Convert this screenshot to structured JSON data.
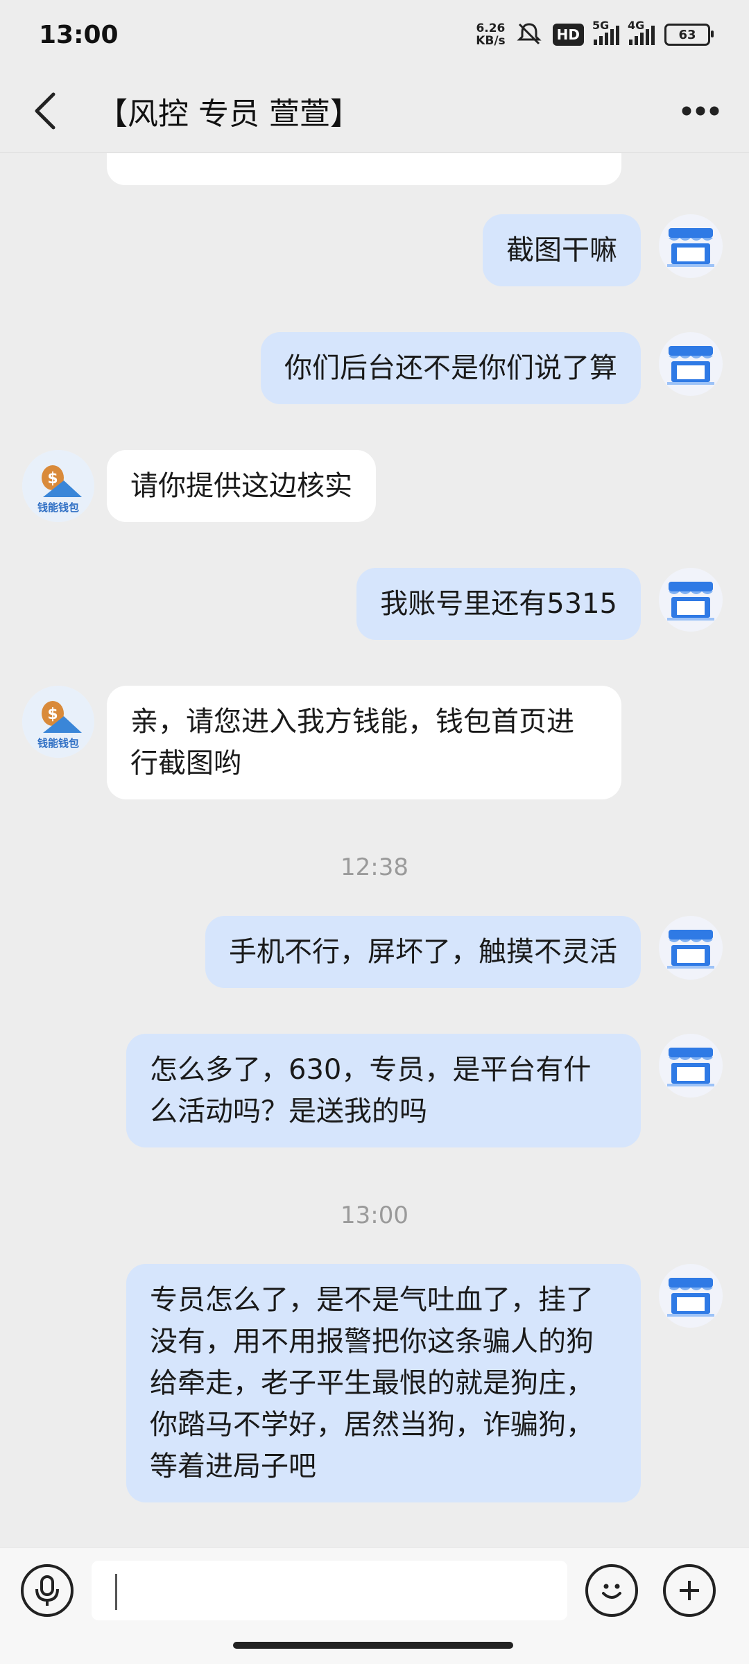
{
  "status_bar": {
    "time": "13:00",
    "net_speed_value": "6.26",
    "net_speed_unit": "KB/s",
    "hd_label": "HD",
    "net1": "5G",
    "net2": "4G",
    "battery": "63"
  },
  "header": {
    "title": "【风控 专员 萱萱】"
  },
  "messages": [
    {
      "side": "me",
      "text": "截图干嘛"
    },
    {
      "side": "me",
      "text": "你们后台还不是你们说了算"
    },
    {
      "side": "them",
      "text": "请你提供这边核实"
    },
    {
      "side": "me",
      "text": "我账号里还有5315"
    },
    {
      "side": "them",
      "text": "亲，请您进入我方钱能，钱包首页进行截图哟"
    },
    {
      "side": "me",
      "text": "手机不行，屏坏了，触摸不灵活"
    },
    {
      "side": "me",
      "text": "怎么多了，630，专员，是平台有什么活动吗？是送我的吗"
    },
    {
      "side": "me",
      "text": "专员怎么了，是不是气吐血了，挂了没有，用不用报警把你这条骗人的狗给牵走，老子平生最恨的就是狗庄，你踏马不学好，居然当狗，诈骗狗，等着进局子吧"
    }
  ],
  "timestamps": [
    "12:38",
    "13:00"
  ],
  "agent_avatar_text": "钱能钱包",
  "icons": {
    "back": "back-chevron-icon",
    "more": "more-dots-icon",
    "voice": "microphone-icon",
    "emoji": "emoji-icon",
    "plus": "plus-icon",
    "my_avatar": "store-icon"
  },
  "colors": {
    "my_bubble": "#d6e5fc",
    "their_bubble": "#ffffff",
    "background": "#ededed"
  }
}
